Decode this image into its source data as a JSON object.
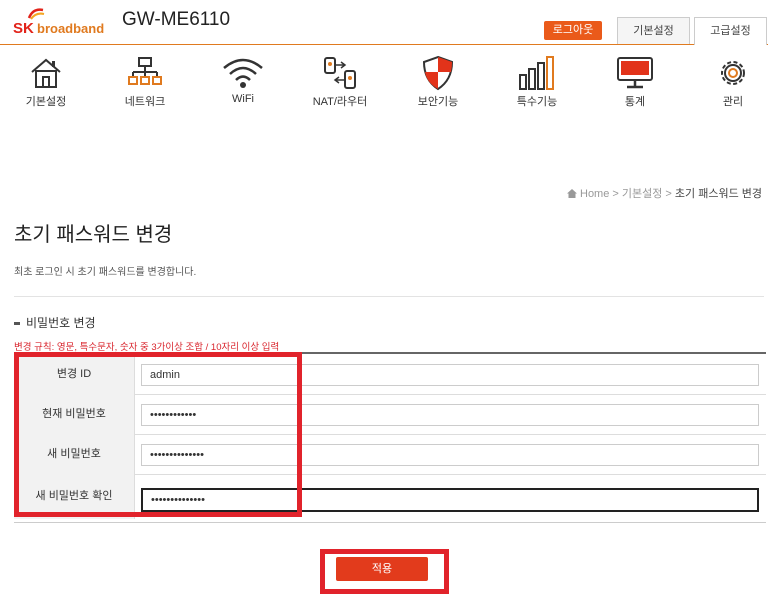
{
  "header": {
    "logo_sk": "SK",
    "logo_brand": "broadband",
    "model": "GW-ME6110",
    "logout_label": "로그아웃",
    "tab_basic": "기본설정",
    "tab_advanced": "고급설정"
  },
  "nav": {
    "items": [
      {
        "label": "기본설정",
        "icon": "house-icon"
      },
      {
        "label": "네트워크",
        "icon": "network-icon"
      },
      {
        "label": "WiFi",
        "icon": "wifi-icon"
      },
      {
        "label": "NAT/라우터",
        "icon": "router-icon"
      },
      {
        "label": "보안기능",
        "icon": "shield-icon"
      },
      {
        "label": "특수기능",
        "icon": "bars-icon"
      },
      {
        "label": "통계",
        "icon": "monitor-icon"
      },
      {
        "label": "관리",
        "icon": "gear-icon"
      }
    ]
  },
  "breadcrumb": {
    "home": "Home",
    "sep1": " > ",
    "parent": "기본설정",
    "sep2": " > ",
    "current": "초기 패스워드 변경"
  },
  "page": {
    "title": "초기 패스워드 변경",
    "description": "최초 로그인 시 초기 패스워드를 변경합니다.",
    "section_title": "비밀번호 변경",
    "rule": "변경 규칙: 영문, 특수문자, 숫자 중 3가이상 조합 / 10자리 이상 입력"
  },
  "form": {
    "rows": [
      {
        "label": "변경 ID",
        "value": "admin"
      },
      {
        "label": "현재 비밀번호",
        "value": "••••••••••••"
      },
      {
        "label": "새 비밀번호",
        "value": "••••••••••••••"
      },
      {
        "label": "새 비밀번호 확인",
        "value": "••••••••••••••"
      }
    ]
  },
  "apply_label": "적용",
  "colors": {
    "accent": "#e07a1f",
    "highlight": "#e1232b",
    "button": "#e23b1c"
  }
}
